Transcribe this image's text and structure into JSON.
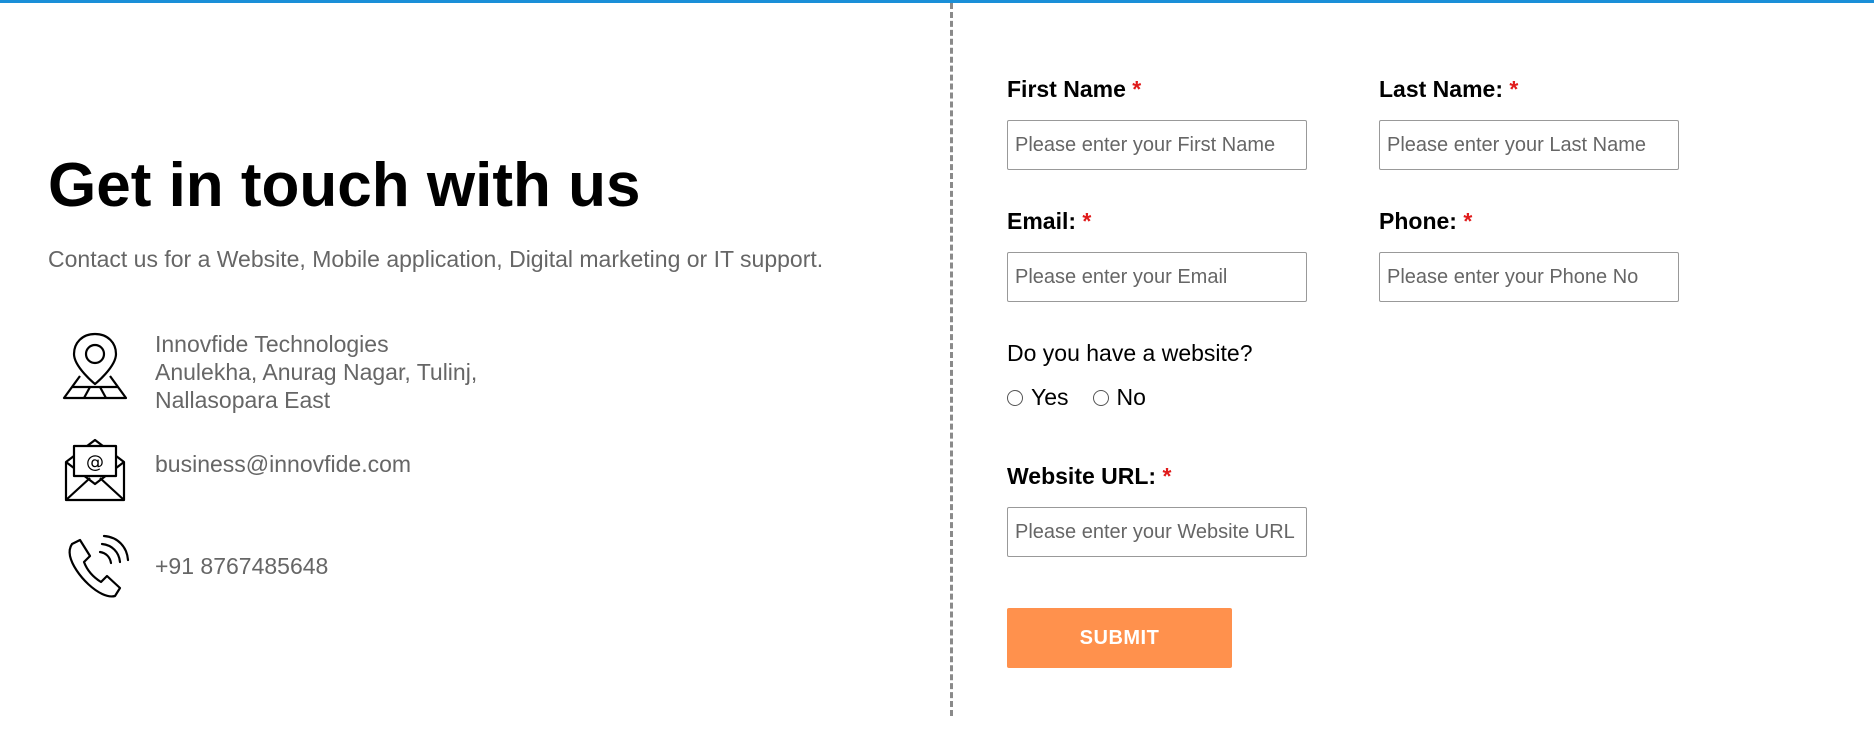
{
  "left": {
    "heading": "Get in touch with us",
    "subtext": "Contact us for a Website, Mobile application, Digital marketing or IT support.",
    "address": {
      "icon": "location-pin-icon",
      "lines": [
        "Innovfide Technologies",
        "Anulekha, Anurag Nagar, Tulinj,",
        "Nallasopara East"
      ]
    },
    "email": {
      "icon": "envelope-at-icon",
      "text": "business@innovfide.com"
    },
    "phone": {
      "icon": "phone-ringing-icon",
      "text": "+91 8767485648"
    }
  },
  "form": {
    "required_mark": "*",
    "first_name": {
      "label": "First Name",
      "placeholder": "Please enter your First Name",
      "value": ""
    },
    "last_name": {
      "label": "Last Name:",
      "placeholder": "Please enter your Last Name",
      "value": ""
    },
    "email": {
      "label": "Email:",
      "placeholder": "Please enter your Email",
      "value": ""
    },
    "phone": {
      "label": "Phone:",
      "placeholder": "Please enter your Phone No",
      "value": ""
    },
    "website_question": "Do you have a website?",
    "website_options": [
      "Yes",
      "No"
    ],
    "website_url": {
      "label": "Website URL:",
      "placeholder": "Please enter your Website URL",
      "value": ""
    },
    "submit_label": "SUBMIT"
  },
  "colors": {
    "top_bar": "#1a8fd8",
    "required": "#e01b1b",
    "submit_bg": "#ff914d",
    "muted_text": "#666666",
    "divider": "#8a8a8a"
  }
}
